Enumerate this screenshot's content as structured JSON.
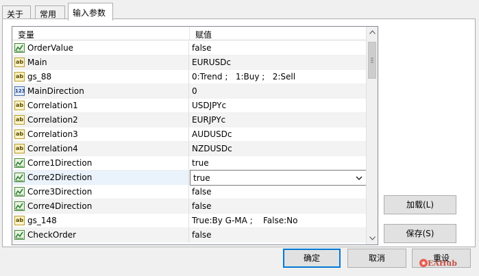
{
  "tabs": [
    {
      "label": "关于"
    },
    {
      "label": "常用"
    },
    {
      "label": "输入参数",
      "active": true
    }
  ],
  "grid": {
    "headers": {
      "variable": "变量",
      "value": "赋值"
    },
    "rows": [
      {
        "icon": "bool",
        "name": "OrderValue",
        "value": "false"
      },
      {
        "icon": "str",
        "name": "Main",
        "value": "EURUSDc"
      },
      {
        "icon": "str",
        "name": "gs_88",
        "value": "0:Trend ;   1:Buy ;   2:Sell"
      },
      {
        "icon": "num",
        "name": "MainDirection",
        "value": "0"
      },
      {
        "icon": "str",
        "name": "Correlation1",
        "value": "USDJPYc"
      },
      {
        "icon": "str",
        "name": "Correlation2",
        "value": "EURJPYc"
      },
      {
        "icon": "str",
        "name": "Correlation3",
        "value": "AUDUSDc"
      },
      {
        "icon": "str",
        "name": "Correlation4",
        "value": "NZDUSDc"
      },
      {
        "icon": "bool",
        "name": "Corre1Direction",
        "value": "true"
      },
      {
        "icon": "bool",
        "name": "Corre2Direction",
        "value": "true",
        "editing": true
      },
      {
        "icon": "bool",
        "name": "Corre3Direction",
        "value": "false"
      },
      {
        "icon": "bool",
        "name": "Corre4Direction",
        "value": "false"
      },
      {
        "icon": "str",
        "name": "gs_148",
        "value": "True:By G-MA ;    False:No"
      },
      {
        "icon": "bool",
        "name": "CheckOrder",
        "value": "false"
      }
    ]
  },
  "side_buttons": {
    "load": "加载(L)",
    "save": "保存(S)"
  },
  "footer_buttons": {
    "ok": "确定",
    "cancel": "取消",
    "reset": "重设"
  },
  "icon_glyphs": {
    "bool": "bool-icon",
    "str": "ab",
    "num": "123"
  },
  "watermark": "EAHub",
  "colors": {
    "accent": "#0078d7",
    "selected_row": "#eaf2fb"
  }
}
